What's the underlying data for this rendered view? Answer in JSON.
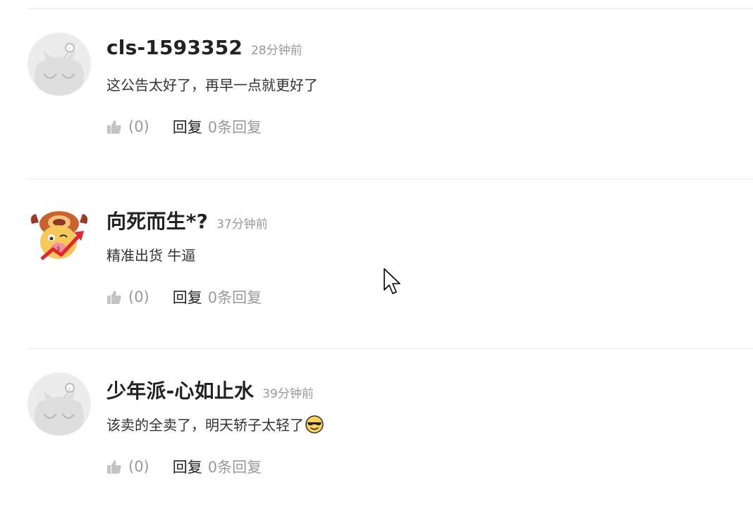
{
  "comments": [
    {
      "username": "cls-1593352",
      "time": "28分钟前",
      "content": "这公告太好了，再早一点就更好了",
      "avatar": "default-cat-avatar",
      "like_count": "(0)",
      "reply_label": "回复",
      "reply_count": "0条回复"
    },
    {
      "username": "向死而生*?",
      "time": "37分钟前",
      "content": "精准出货 牛逼",
      "avatar": "bull-cartoon-avatar",
      "like_count": "(0)",
      "reply_label": "回复",
      "reply_count": "0条回复"
    },
    {
      "username": "少年派-心如止水",
      "time": "39分钟前",
      "content": "该卖的全卖了，明天轿子太轻了",
      "emoji": "sunglasses-emoji",
      "avatar": "default-cat-avatar",
      "like_count": "(0)",
      "reply_label": "回复",
      "reply_count": "0条回复"
    }
  ],
  "colors": {
    "text": "#222222",
    "muted": "#999999",
    "divider": "#e9e9e9",
    "icon": "#c4c4c4"
  }
}
